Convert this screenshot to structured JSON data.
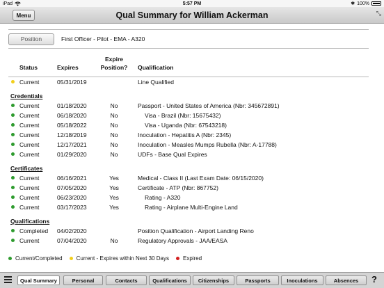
{
  "status_bar": {
    "device": "iPad",
    "time": "5:57 PM",
    "battery": "100%"
  },
  "nav": {
    "menu_label": "Menu",
    "title": "Qual Summary for William Ackerman"
  },
  "position": {
    "button_label": "Position",
    "value": "First Officer - Pilot - EMA - A320"
  },
  "columns": {
    "status": "Status",
    "expires": "Expires",
    "expire_position_line1": "Expire",
    "expire_position_line2": "Position?",
    "qualification": "Qualification"
  },
  "colors": {
    "green": "#2e9b2e",
    "yellow": "#f2cf1c",
    "red": "#d32020"
  },
  "top_rows": [
    {
      "dot": "yellow",
      "status": "Current",
      "expires": "05/31/2019",
      "expire_position": "",
      "qualification": "Line Qualified",
      "indent": false
    }
  ],
  "sections": [
    {
      "title": "Credentials",
      "rows": [
        {
          "dot": "green",
          "status": "Current",
          "expires": "01/18/2020",
          "expire_position": "No",
          "qualification": "Passport - United States of America (Nbr: 345672891)",
          "indent": false
        },
        {
          "dot": "green",
          "status": "Current",
          "expires": "06/18/2020",
          "expire_position": "No",
          "qualification": "Visa - Brazil (Nbr: 15675432)",
          "indent": true
        },
        {
          "dot": "green",
          "status": "Current",
          "expires": "05/18/2022",
          "expire_position": "No",
          "qualification": "Visa - Uganda (Nbr: 67543218)",
          "indent": true
        },
        {
          "dot": "green",
          "status": "Current",
          "expires": "12/18/2019",
          "expire_position": "No",
          "qualification": "Inoculation - Hepatitis A (Nbr: 2345)",
          "indent": false
        },
        {
          "dot": "green",
          "status": "Current",
          "expires": "12/17/2021",
          "expire_position": "No",
          "qualification": "Inoculation - Measles Mumps Rubella (Nbr: A-17788)",
          "indent": false
        },
        {
          "dot": "green",
          "status": "Current",
          "expires": "01/29/2020",
          "expire_position": "No",
          "qualification": "UDFs - Base Qual Expires",
          "indent": false
        }
      ]
    },
    {
      "title": "Certificates",
      "rows": [
        {
          "dot": "green",
          "status": "Current",
          "expires": "06/16/2021",
          "expire_position": "Yes",
          "qualification": "Medical - Class II (Last Exam Date: 06/15/2020)",
          "indent": false
        },
        {
          "dot": "green",
          "status": "Current",
          "expires": "07/05/2020",
          "expire_position": "Yes",
          "qualification": "Certificate - ATP (Nbr: 867752)",
          "indent": false
        },
        {
          "dot": "green",
          "status": "Current",
          "expires": "06/23/2020",
          "expire_position": "Yes",
          "qualification": "Rating - A320",
          "indent": true
        },
        {
          "dot": "green",
          "status": "Current",
          "expires": "03/17/2023",
          "expire_position": "Yes",
          "qualification": "Rating - Airplane Multi-Engine Land",
          "indent": true
        }
      ]
    },
    {
      "title": "Qualifications",
      "rows": [
        {
          "dot": "green",
          "status": "Completed",
          "expires": "04/02/2020",
          "expire_position": "",
          "qualification": "Position Qualification - Airport Landing Reno",
          "indent": false
        },
        {
          "dot": "green",
          "status": "Current",
          "expires": "07/04/2020",
          "expire_position": "No",
          "qualification": "Regulatory Approvals - JAA/EASA",
          "indent": false
        }
      ]
    }
  ],
  "legend": [
    {
      "color": "green",
      "label": "Current/Completed"
    },
    {
      "color": "yellow",
      "label": "Current - Expires within Next 30 Days"
    },
    {
      "color": "red",
      "label": "Expired"
    }
  ],
  "tabs": [
    {
      "label": "Qual Summary",
      "active": true
    },
    {
      "label": "Personal",
      "active": false
    },
    {
      "label": "Contacts",
      "active": false
    },
    {
      "label": "Qualifications",
      "active": false
    },
    {
      "label": "Citizenships",
      "active": false
    },
    {
      "label": "Passports",
      "active": false
    },
    {
      "label": "Inoculations",
      "active": false
    },
    {
      "label": "Absences",
      "active": false
    }
  ],
  "help_label": "?"
}
